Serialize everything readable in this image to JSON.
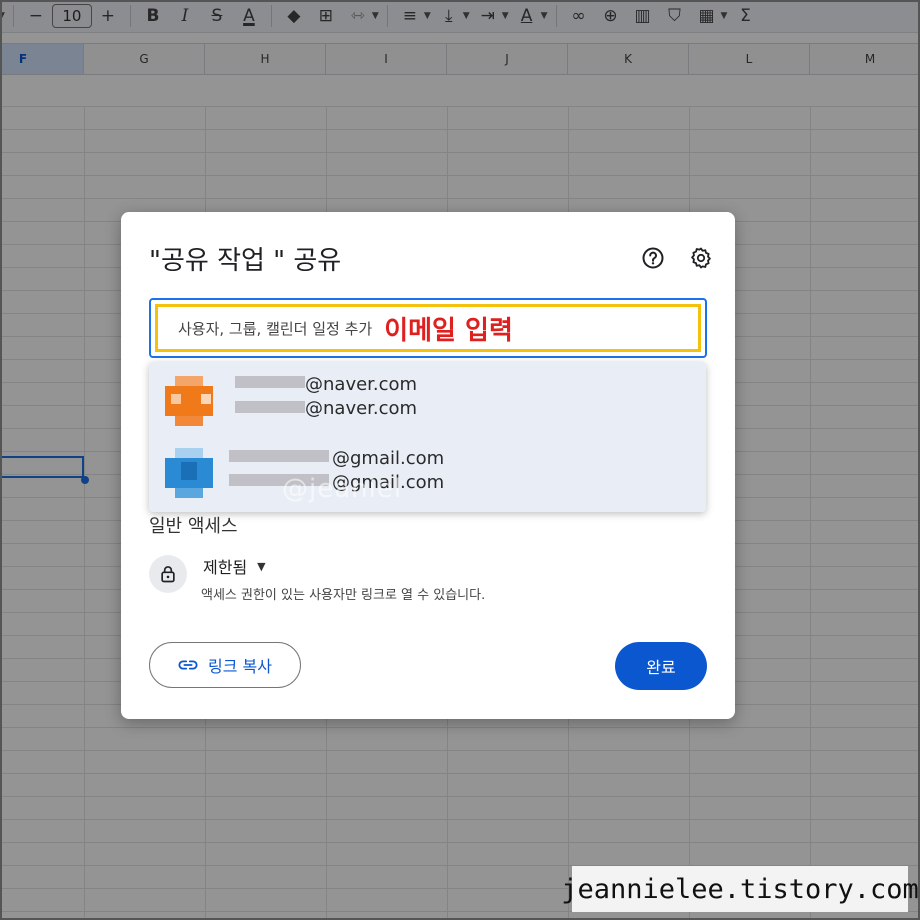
{
  "toolbar": {
    "font_size": "10",
    "icons": [
      "minus-icon",
      "plus-icon",
      "bold-icon",
      "italic-icon",
      "strikethrough-icon",
      "text-color-icon",
      "fill-color-icon",
      "borders-icon",
      "merge-icon",
      "align-icon",
      "valign-icon",
      "wrap-icon",
      "rotate-icon",
      "link-icon",
      "comment-icon",
      "chart-icon",
      "filter-icon",
      "functions-icon",
      "sum-icon"
    ]
  },
  "sheet": {
    "columns": [
      "F",
      "G",
      "H",
      "I",
      "J",
      "K",
      "L",
      "M"
    ],
    "selected_column": "F"
  },
  "dialog": {
    "title": "\"공유 작업 \" 공유",
    "help_icon": "help-icon",
    "settings_icon": "gear-icon",
    "search": {
      "placeholder": "사용자, 그룹, 캘린더 일정 추가",
      "annotation": "이메일 입력"
    },
    "suggestions": [
      {
        "line1": "@naver.com",
        "line2": "@naver.com",
        "avatar_color": "#f07a1a"
      },
      {
        "line1": "@gmail.com",
        "line2": "@gmail.com",
        "avatar_color": "#2a8ad4"
      }
    ],
    "general_access": {
      "title": "일반 액세스",
      "selected": "제한됨",
      "description": "액세스 권한이 있는 사용자만 링크로 열 수 있습니다."
    },
    "copy_link_label": "링크 복사",
    "done_label": "완료"
  },
  "watermarks": {
    "faint": "@jeaniel",
    "site": "jeannielee.tistory.com"
  },
  "colors": {
    "accent": "#0b57d0",
    "annotation": "#e01f1f",
    "highlight_border": "#f4c20d"
  }
}
